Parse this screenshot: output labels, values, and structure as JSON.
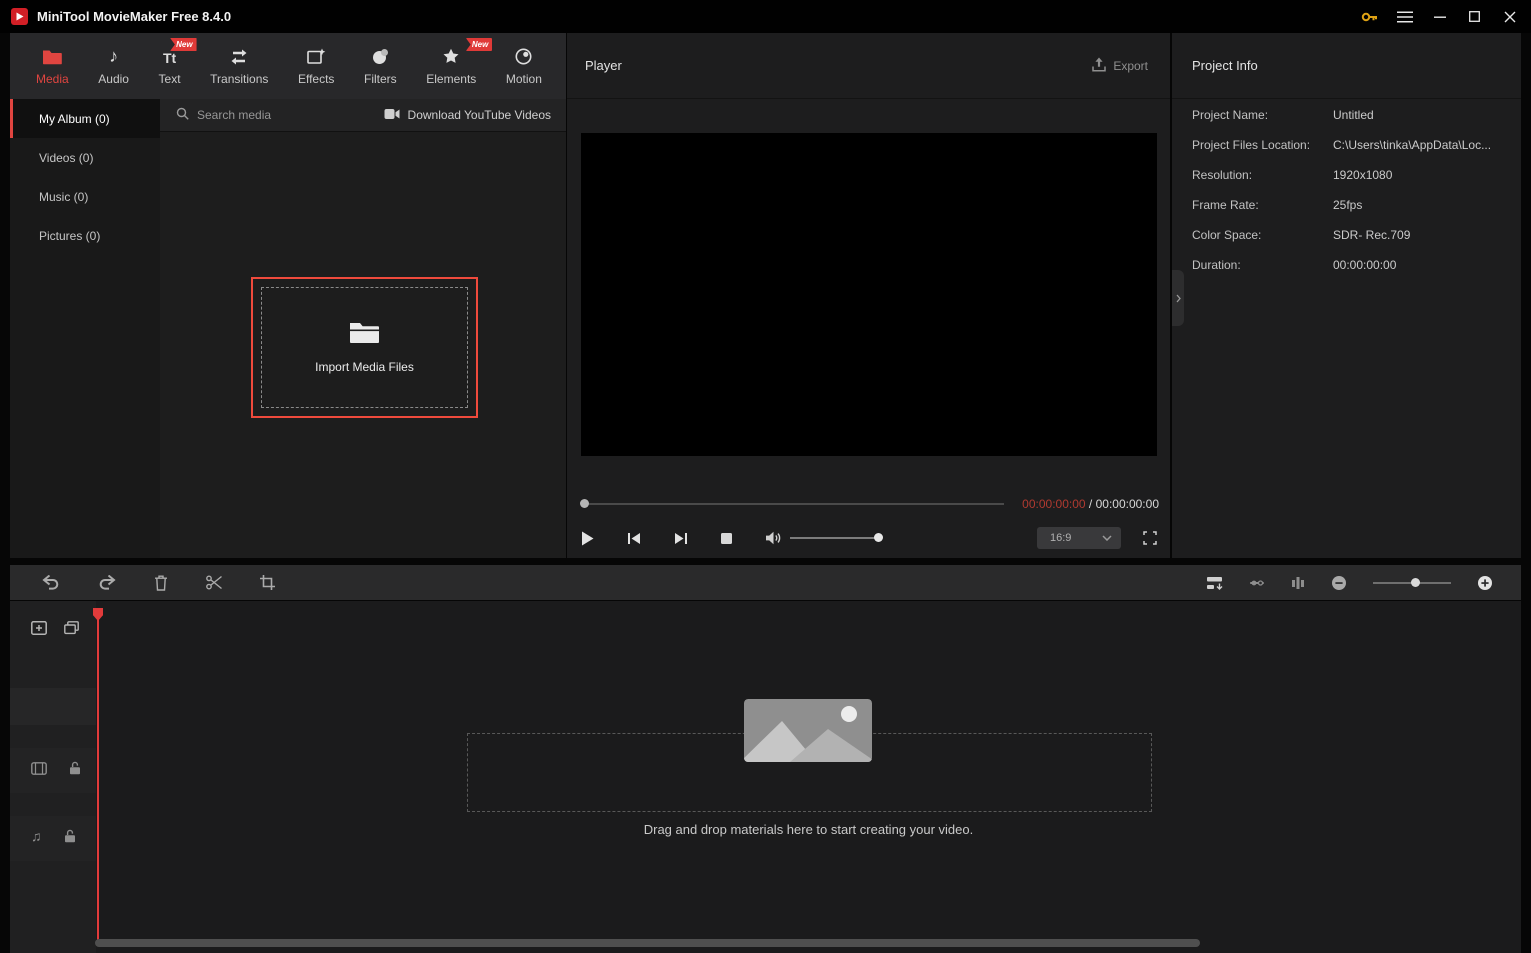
{
  "titlebar": {
    "app_title": "MiniTool MovieMaker Free 8.4.0"
  },
  "ribbon_tabs": [
    {
      "label": "Media"
    },
    {
      "label": "Audio"
    },
    {
      "label": "Text",
      "badge": "New"
    },
    {
      "label": "Transitions"
    },
    {
      "label": "Effects"
    },
    {
      "label": "Filters"
    },
    {
      "label": "Elements",
      "badge": "New"
    },
    {
      "label": "Motion"
    }
  ],
  "album_sidebar": [
    {
      "label": "My Album (0)"
    },
    {
      "label": "Videos (0)"
    },
    {
      "label": "Music (0)"
    },
    {
      "label": "Pictures (0)"
    }
  ],
  "media_panel": {
    "search_placeholder": "Search media",
    "download_label": "Download YouTube Videos",
    "import_label": "Import Media Files"
  },
  "player": {
    "title": "Player",
    "export_label": "Export",
    "current_time": "00:00:00:00",
    "time_separator": " / ",
    "total_time": "00:00:00:00",
    "aspect_ratio": "16:9"
  },
  "project_info": {
    "title": "Project Info",
    "rows": [
      {
        "label": "Project Name:",
        "value": "Untitled"
      },
      {
        "label": "Project Files Location:",
        "value": "C:\\Users\\tinka\\AppData\\Loc..."
      },
      {
        "label": "Resolution:",
        "value": "1920x1080"
      },
      {
        "label": "Frame Rate:",
        "value": "25fps"
      },
      {
        "label": "Color Space:",
        "value": "SDR- Rec.709"
      },
      {
        "label": "Duration:",
        "value": "00:00:00:00"
      }
    ]
  },
  "timeline": {
    "drop_hint": "Drag and drop materials here to start creating your video."
  },
  "colors": {
    "accent_red": "#e04540",
    "key_yellow": "#dfa214"
  }
}
